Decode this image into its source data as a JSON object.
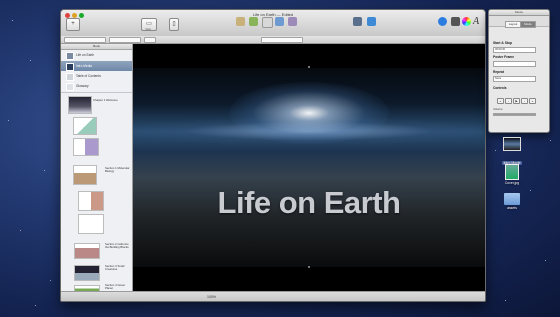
{
  "window": {
    "title": "Life on Earth",
    "subtitle": "Edited",
    "toolbar_buttons": [
      "View",
      "Orientation",
      "Media"
    ],
    "right_buttons": [
      "Inspector",
      "Media",
      "Colors",
      "Fonts"
    ]
  },
  "sidebar": {
    "header": "Book",
    "items": [
      {
        "label": "Life on Earth",
        "icon": "book-icon"
      },
      {
        "label": "Intro Media",
        "icon": "media-icon",
        "selected": true
      },
      {
        "label": "Table of Contents",
        "icon": "toc-icon"
      },
      {
        "label": "Glossary",
        "icon": "glossary-icon"
      }
    ],
    "thumbnails": [
      {
        "label": "Chapter 1 Welcome"
      },
      {
        "label": ""
      },
      {
        "label": ""
      },
      {
        "label": "Section 1 Molecular Biology"
      },
      {
        "label": ""
      },
      {
        "label": ""
      },
      {
        "label": "Section 2 Cells Are the Building Blocks"
      },
      {
        "label": "Section 3 Small Creatures"
      },
      {
        "label": "Section 4 Green Planet"
      }
    ]
  },
  "canvas": {
    "title": "Life on Earth"
  },
  "statusbar": {
    "zoom": "100%"
  },
  "inspector": {
    "title": "Movie",
    "tabs": [
      "Layout",
      "Movie"
    ],
    "start_stop_label": "Start & Stop",
    "start_value": "00:00:00",
    "poster_frame_label": "Poster Frame",
    "repeat_label": "Repeat",
    "repeat_value": "None",
    "controls_label": "Controls",
    "volume_label": "Volume"
  },
  "desktop": {
    "icons": [
      {
        "name": "Intro Movie",
        "icon": "movie-thumbnail-icon",
        "selected": true
      },
      {
        "name": "Cover.jpg",
        "icon": "image-file-icon"
      },
      {
        "name": "assets",
        "icon": "folder-icon"
      }
    ]
  },
  "colors": {
    "desktop": "#233a73",
    "selection": "#6f88a9",
    "title_text": "#c8ccd1"
  }
}
